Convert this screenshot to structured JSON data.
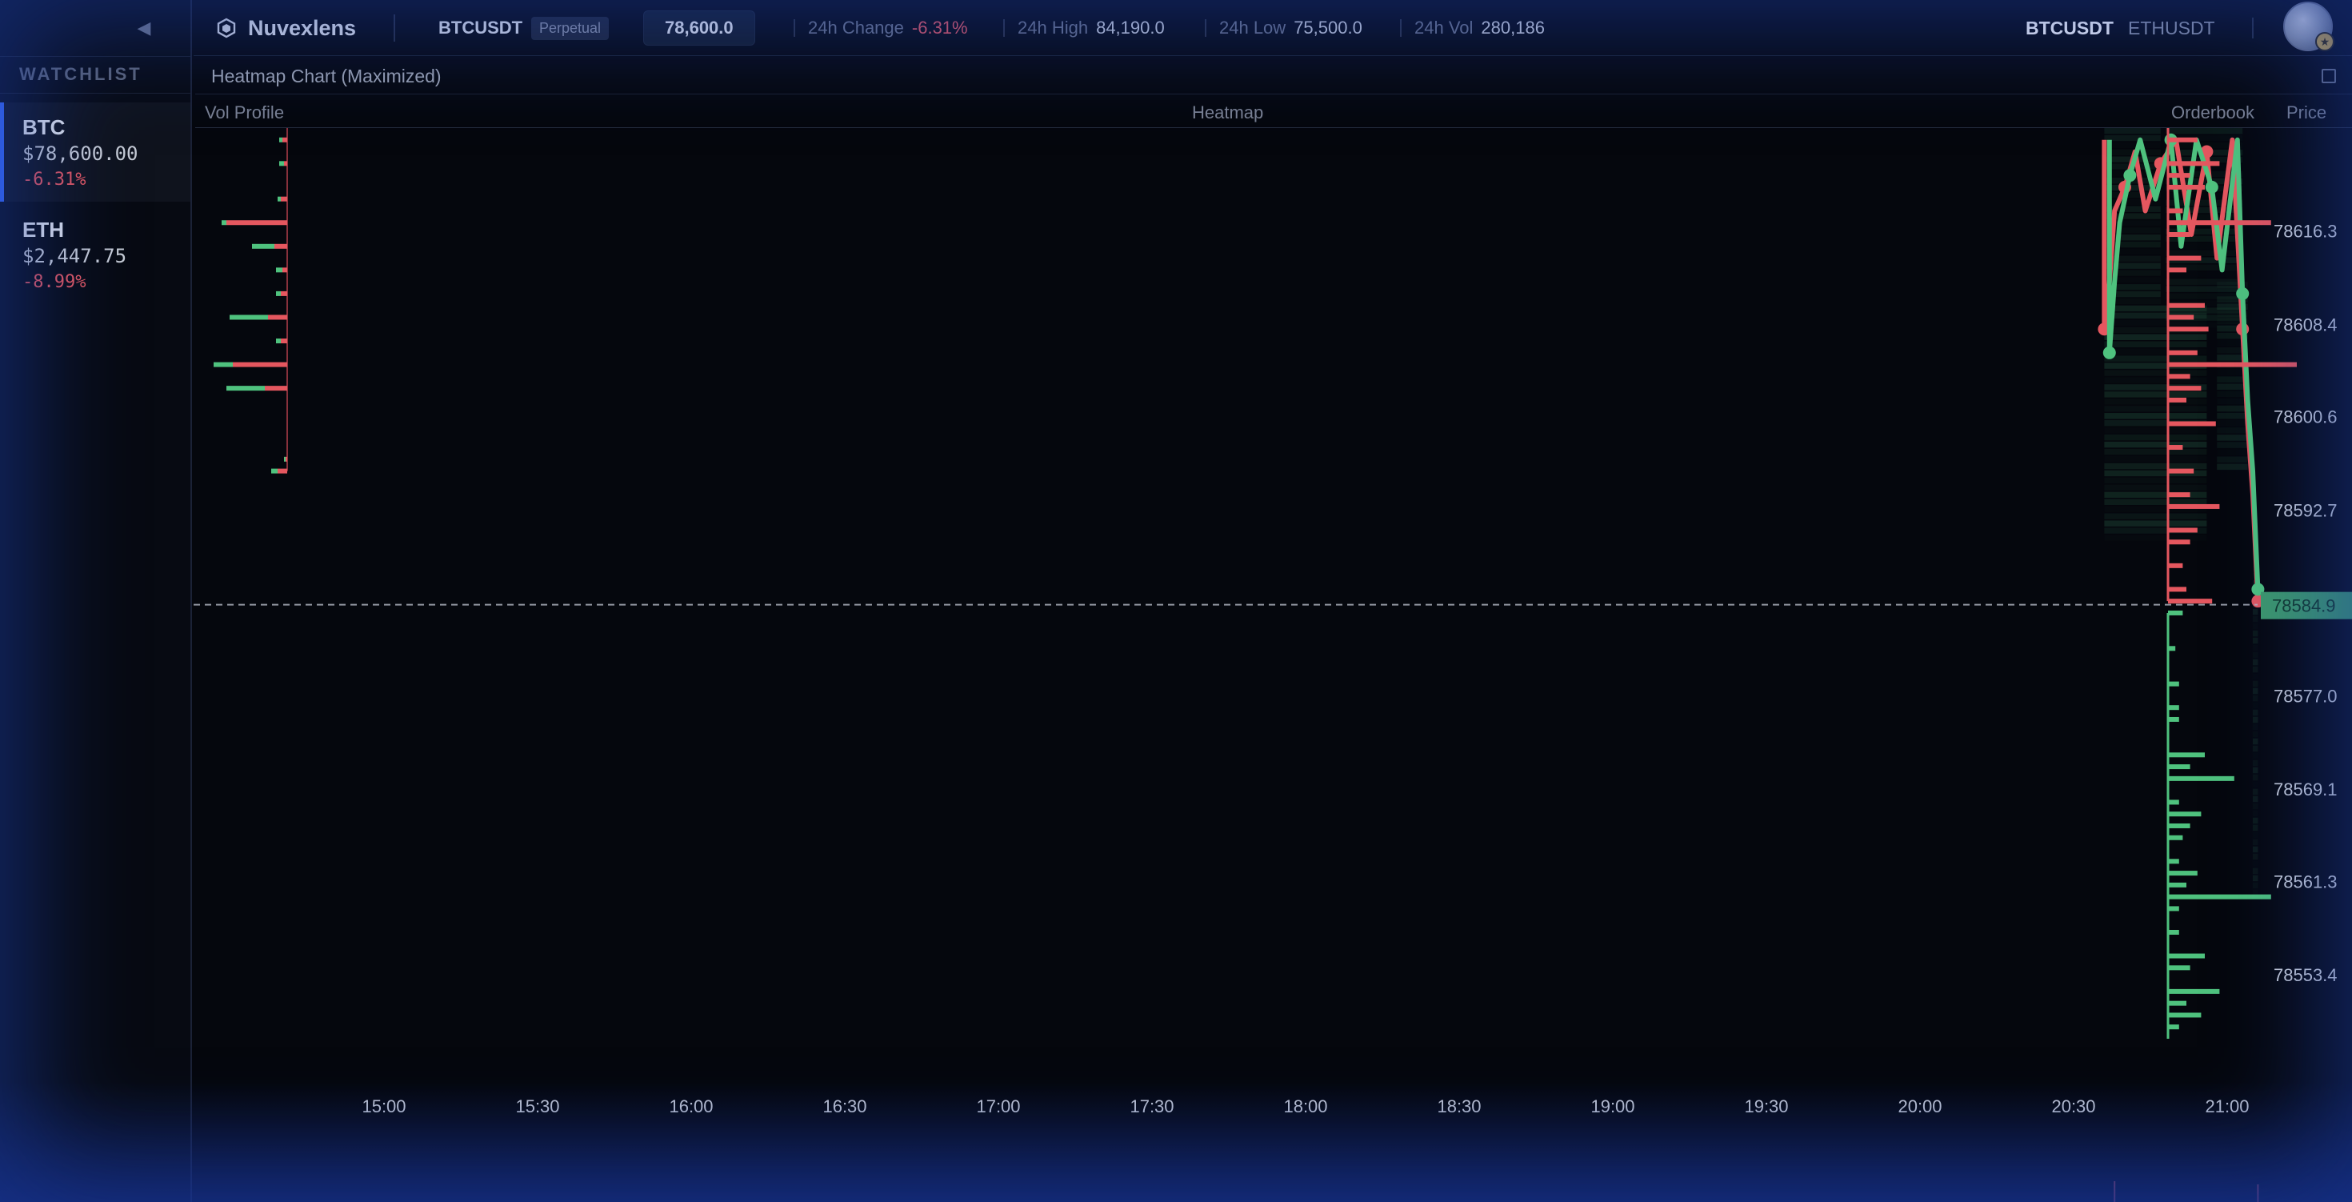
{
  "sidebar": {
    "collapse_glyph": "◀",
    "watchlist_title": "WATCHLIST",
    "items": [
      {
        "symbol": "BTC",
        "price": "$78,600.00",
        "change": "-6.31%",
        "active": true
      },
      {
        "symbol": "ETH",
        "price": "$2,447.75",
        "change": "-8.99%",
        "active": false
      }
    ]
  },
  "topbar": {
    "brand": "Nuvexlens",
    "symbol": "BTCUSDT",
    "badge": "Perpetual",
    "price": "78,600.0",
    "change_label": "24h Change",
    "change_value": "-6.31%",
    "high_label": "24h High",
    "high_value": "84,190.0",
    "low_label": "24h Low",
    "low_value": "75,500.0",
    "vol_label": "24h Vol",
    "vol_value": "280,186",
    "tabs": [
      {
        "label": "BTCUSDT",
        "active": true
      },
      {
        "label": "ETHUSDT",
        "active": false
      }
    ]
  },
  "panel": {
    "title": "Heatmap Chart (Maximized)",
    "headers": {
      "vol_profile": "Vol Profile",
      "heatmap": "Heatmap",
      "orderbook": "Orderbook",
      "price": "Price"
    }
  },
  "colors": {
    "bid": "#4fc27e",
    "ask": "#e5575f",
    "background": "#05070d",
    "current_price_tag": "#3e9a6b"
  },
  "chart_data": {
    "type": "heatmap",
    "title": "",
    "x_tick_labels": [
      "15:00",
      "15:30",
      "16:00",
      "16:30",
      "17:00",
      "17:30",
      "18:00",
      "18:30",
      "19:00",
      "19:30",
      "20:00",
      "20:30",
      "21:00"
    ],
    "y_tick_labels": [
      "78616.3",
      "78608.4",
      "78600.6",
      "78592.7",
      "78577.0",
      "78569.1",
      "78561.3",
      "78553.4"
    ],
    "ylim": [
      78548,
      78625
    ],
    "current_price": "78584.9",
    "price_series": [
      {
        "name": "",
        "color": "ask",
        "points": [
          [
            "20:36",
            78624
          ],
          [
            "20:36",
            78608
          ],
          [
            "20:37",
            78612
          ],
          [
            "20:38",
            78618
          ],
          [
            "20:40",
            78620
          ],
          [
            "20:42",
            78623
          ],
          [
            "20:44",
            78618
          ],
          [
            "20:47",
            78622
          ],
          [
            "20:50",
            78624
          ],
          [
            "20:53",
            78616
          ],
          [
            "20:56",
            78623
          ],
          [
            "20:58",
            78614
          ],
          [
            "21:01",
            78624
          ],
          [
            "21:03",
            78608
          ],
          [
            "21:04",
            78600
          ],
          [
            "21:05",
            78594
          ],
          [
            "21:06",
            78585
          ]
        ]
      },
      {
        "name": "",
        "color": "bid",
        "points": [
          [
            "20:37",
            78624
          ],
          [
            "20:37",
            78606
          ],
          [
            "20:38",
            78612
          ],
          [
            "20:39",
            78617
          ],
          [
            "20:41",
            78621
          ],
          [
            "20:43",
            78624
          ],
          [
            "20:46",
            78619
          ],
          [
            "20:49",
            78624
          ],
          [
            "20:51",
            78615
          ],
          [
            "20:54",
            78624
          ],
          [
            "20:57",
            78620
          ],
          [
            "20:59",
            78613
          ],
          [
            "21:02",
            78624
          ],
          [
            "21:03",
            78611
          ],
          [
            "21:04",
            78602
          ],
          [
            "21:05",
            78596
          ],
          [
            "21:06",
            78586
          ]
        ]
      }
    ],
    "vol_profile": [
      {
        "price": 78624,
        "bid": 2,
        "ask": 3
      },
      {
        "price": 78622,
        "bid": 3,
        "ask": 2
      },
      {
        "price": 78619,
        "bid": 2,
        "ask": 4
      },
      {
        "price": 78617,
        "bid": 3,
        "ask": 38
      },
      {
        "price": 78615,
        "bid": 14,
        "ask": 8
      },
      {
        "price": 78613,
        "bid": 4,
        "ask": 3
      },
      {
        "price": 78611,
        "bid": 3,
        "ask": 4
      },
      {
        "price": 78609,
        "bid": 24,
        "ask": 12
      },
      {
        "price": 78607,
        "bid": 3,
        "ask": 4
      },
      {
        "price": 78605,
        "bid": 12,
        "ask": 34
      },
      {
        "price": 78603,
        "bid": 24,
        "ask": 14
      },
      {
        "price": 78597,
        "bid": 1,
        "ask": 1
      },
      {
        "price": 78596,
        "bid": 4,
        "ask": 6
      }
    ],
    "orderbook": {
      "asks": [
        {
          "price": 78624,
          "size": 8
        },
        {
          "price": 78622,
          "size": 14
        },
        {
          "price": 78621,
          "size": 6
        },
        {
          "price": 78620,
          "size": 10
        },
        {
          "price": 78618,
          "size": 4
        },
        {
          "price": 78617,
          "size": 28
        },
        {
          "price": 78616,
          "size": 6
        },
        {
          "price": 78614,
          "size": 9
        },
        {
          "price": 78613,
          "size": 5
        },
        {
          "price": 78610,
          "size": 10
        },
        {
          "price": 78609,
          "size": 7
        },
        {
          "price": 78608,
          "size": 11
        },
        {
          "price": 78606,
          "size": 8
        },
        {
          "price": 78605,
          "size": 35
        },
        {
          "price": 78604,
          "size": 6
        },
        {
          "price": 78603,
          "size": 9
        },
        {
          "price": 78602,
          "size": 5
        },
        {
          "price": 78600,
          "size": 13
        },
        {
          "price": 78598,
          "size": 4
        },
        {
          "price": 78596,
          "size": 7
        },
        {
          "price": 78594,
          "size": 6
        },
        {
          "price": 78593,
          "size": 14
        },
        {
          "price": 78591,
          "size": 8
        },
        {
          "price": 78590,
          "size": 6
        },
        {
          "price": 78588,
          "size": 4
        },
        {
          "price": 78586,
          "size": 5
        },
        {
          "price": 78585,
          "size": 12
        }
      ],
      "bids": [
        {
          "price": 78584,
          "size": 4
        },
        {
          "price": 78581,
          "size": 2
        },
        {
          "price": 78578,
          "size": 3
        },
        {
          "price": 78576,
          "size": 3
        },
        {
          "price": 78575,
          "size": 3
        },
        {
          "price": 78572,
          "size": 10
        },
        {
          "price": 78571,
          "size": 6
        },
        {
          "price": 78570,
          "size": 18
        },
        {
          "price": 78568,
          "size": 3
        },
        {
          "price": 78567,
          "size": 9
        },
        {
          "price": 78566,
          "size": 6
        },
        {
          "price": 78565,
          "size": 4
        },
        {
          "price": 78563,
          "size": 3
        },
        {
          "price": 78562,
          "size": 8
        },
        {
          "price": 78561,
          "size": 5
        },
        {
          "price": 78560,
          "size": 28
        },
        {
          "price": 78559,
          "size": 3
        },
        {
          "price": 78557,
          "size": 3
        },
        {
          "price": 78555,
          "size": 10
        },
        {
          "price": 78554,
          "size": 6
        },
        {
          "price": 78552,
          "size": 14
        },
        {
          "price": 78551,
          "size": 5
        },
        {
          "price": 78550,
          "size": 9
        },
        {
          "price": 78549,
          "size": 3
        }
      ]
    },
    "heat_cells": [
      {
        "t_from": "20:36",
        "t_to": "20:56",
        "p_from": 78590,
        "p_to": 78610,
        "intensity": 0.45
      },
      {
        "t_from": "20:36",
        "t_to": "20:47",
        "p_from": 78610,
        "p_to": 78625,
        "intensity": 0.35
      },
      {
        "t_from": "20:48",
        "t_to": "21:03",
        "p_from": 78608,
        "p_to": 78625,
        "intensity": 0.3
      },
      {
        "t_from": "20:58",
        "t_to": "21:04",
        "p_from": 78596,
        "p_to": 78612,
        "intensity": 0.35
      },
      {
        "t_from": "21:05",
        "t_to": "21:06",
        "p_from": 78560,
        "p_to": 78588,
        "intensity": 0.3
      }
    ]
  }
}
